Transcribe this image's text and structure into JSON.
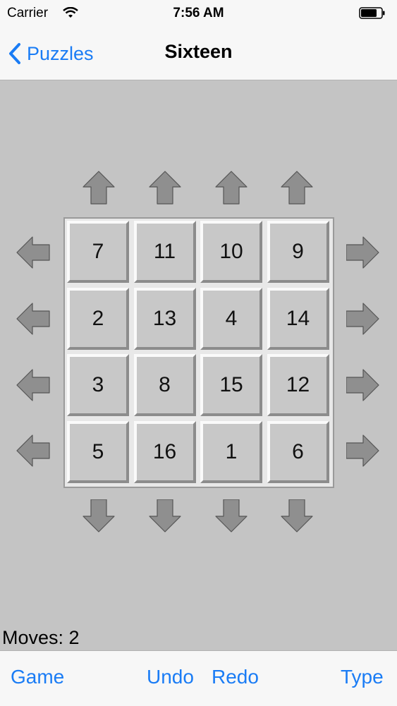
{
  "status": {
    "carrier": "Carrier",
    "time": "7:56 AM"
  },
  "nav": {
    "back_label": "Puzzles",
    "title": "Sixteen"
  },
  "grid": [
    [
      "7",
      "11",
      "10",
      "9"
    ],
    [
      "2",
      "13",
      "4",
      "14"
    ],
    [
      "3",
      "8",
      "15",
      "12"
    ],
    [
      "5",
      "16",
      "1",
      "6"
    ]
  ],
  "moves_label": "Moves: 2",
  "toolbar": {
    "game": "Game",
    "undo": "Undo",
    "redo": "Redo",
    "type": "Type"
  },
  "colors": {
    "accent": "#1a7cf5",
    "background": "#c4c4c4",
    "tile": "#c8c8c8",
    "arrow": "#8f8f8f"
  },
  "icons": {
    "up": "arrow-up-icon",
    "down": "arrow-down-icon",
    "left": "arrow-left-icon",
    "right": "arrow-right-icon"
  }
}
